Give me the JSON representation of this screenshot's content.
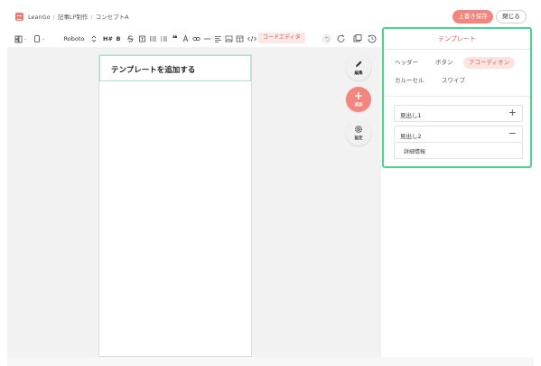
{
  "header": {
    "breadcrumbs": [
      "LeanGo",
      "記事LP制作",
      "コンセプトA"
    ],
    "separator": "/",
    "save_label": "上書き保存",
    "close_label": "閉じる"
  },
  "toolbar": {
    "font_name": "Roboto",
    "heading_label": "H#",
    "bold_label": "B",
    "code_editor_label": "コードエディタ"
  },
  "canvas": {
    "template_title": "テンプレートを追加する"
  },
  "floating_buttons": {
    "edit_label": "編集",
    "add_label": "追加",
    "settings_label": "設定"
  },
  "template_panel": {
    "title": "テンプレート",
    "categories": [
      "ヘッダー",
      "ボタン",
      "アコーディオン",
      "カルーセル",
      "スワイプ"
    ],
    "active_category": "アコーディオン",
    "accordion": [
      {
        "title": "見出し1",
        "state_icon": "+"
      },
      {
        "title": "見出し2",
        "state_icon": "−",
        "body": "詳細情報"
      }
    ]
  },
  "colors": {
    "accent": "#f3857f",
    "highlight_border": "#4ad48f"
  }
}
